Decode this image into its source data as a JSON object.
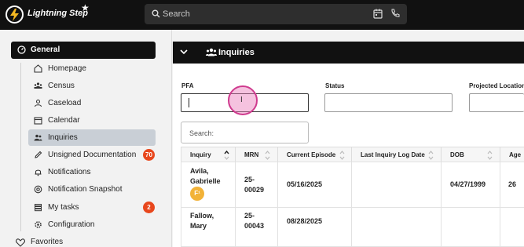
{
  "app": {
    "name": "Lightning Step",
    "search_placeholder": "Search"
  },
  "sidebar": {
    "section": "General",
    "items": [
      {
        "label": "Homepage",
        "icon": "home-icon"
      },
      {
        "label": "Census",
        "icon": "people-icon"
      },
      {
        "label": "Caseload",
        "icon": "person-icon"
      },
      {
        "label": "Calendar",
        "icon": "calendar-icon"
      },
      {
        "label": "Inquiries",
        "icon": "users-icon",
        "active": true
      },
      {
        "label": "Unsigned Documentation",
        "icon": "pen-icon",
        "badge": "70"
      },
      {
        "label": "Notifications",
        "icon": "bell-icon"
      },
      {
        "label": "Notification Snapshot",
        "icon": "at-icon"
      },
      {
        "label": "My tasks",
        "icon": "list-icon",
        "badge": "2"
      },
      {
        "label": "Configuration",
        "icon": "gear-icon"
      }
    ],
    "favorites": "Favorites"
  },
  "panel": {
    "title": "Inquiries",
    "filters": {
      "pfa_label": "PFA",
      "pfa_value": "",
      "status_label": "Status",
      "status_value": "",
      "projected_location_label": "Projected Location",
      "projected_location_value": ""
    },
    "table_search_placeholder": "Search:",
    "columns": [
      "Inquiry",
      "MRN",
      "Current Episode",
      "Last Inquiry Log Date",
      "DOB",
      "Age"
    ],
    "rows": [
      {
        "name_line1": "Avila,",
        "name_line2": "Gabrielle",
        "avatar": "F¹",
        "mrn_line1": "25-",
        "mrn_line2": "00029",
        "current_episode": "05/16/2025",
        "last_log": "",
        "dob": "04/27/1999",
        "age": "26"
      },
      {
        "name_line1": "Fallow,",
        "name_line2": "Mary",
        "avatar": "",
        "mrn_line1": "25-",
        "mrn_line2": "00043",
        "current_episode": "08/28/2025",
        "last_log": "",
        "dob": "",
        "age": ""
      }
    ]
  },
  "colors": {
    "topbar": "#111111",
    "active_nav": "#c9cfd6",
    "badge": "#e8471d",
    "avatar": "#f2b238",
    "click_indicator": "#cf3a8e"
  }
}
